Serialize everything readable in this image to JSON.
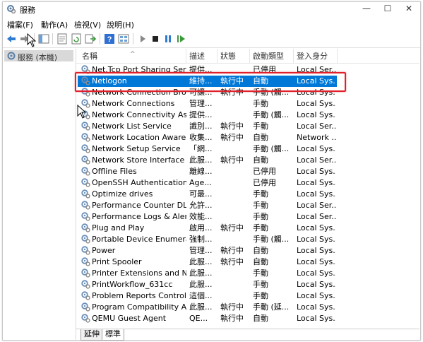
{
  "window": {
    "title": "服務"
  },
  "menu": [
    "檔案(F)",
    "動作(A)",
    "檢視(V)",
    "說明(H)"
  ],
  "toolbar_icons": [
    "back-arrow-icon",
    "forward-arrow-icon",
    "console-tree-icon",
    "properties-icon",
    "refresh-icon",
    "export-list-icon",
    "help-icon",
    "view-icon",
    "play-icon",
    "stop-icon",
    "pause-icon",
    "restart-icon"
  ],
  "tree": {
    "node_label": "服務 (本機)"
  },
  "columns": {
    "name": "名稱",
    "desc": "描述",
    "status": "狀態",
    "startup": "啟動類型",
    "logon": "登入身分"
  },
  "services": [
    {
      "name": "Net.Tcp Port Sharing Servi...",
      "desc": "提供...",
      "status": "",
      "startup": "已停用",
      "logon": "Local Ser..."
    },
    {
      "name": "Netlogon",
      "desc": "維持...",
      "status": "執行中",
      "startup": "自動",
      "logon": "Local Sys...",
      "selected": true
    },
    {
      "name": "Network Connection Broker",
      "desc": "可讓...",
      "status": "執行中",
      "startup": "手動 (觸...",
      "logon": "Local Sys..."
    },
    {
      "name": "Network Connections",
      "desc": "管理...",
      "status": "",
      "startup": "手動",
      "logon": "Local Sys..."
    },
    {
      "name": "Network Connectivity Assi...",
      "desc": "提供...",
      "status": "",
      "startup": "手動 (觸...",
      "logon": "Local Sys..."
    },
    {
      "name": "Network List Service",
      "desc": "識別...",
      "status": "執行中",
      "startup": "手動",
      "logon": "Local Ser..."
    },
    {
      "name": "Network Location Awaren...",
      "desc": "收集...",
      "status": "執行中",
      "startup": "自動",
      "logon": "Network ..."
    },
    {
      "name": "Network Setup Service",
      "desc": "「網...",
      "status": "",
      "startup": "手動 (觸...",
      "logon": "Local Sys..."
    },
    {
      "name": "Network Store Interface S...",
      "desc": "此服...",
      "status": "執行中",
      "startup": "自動",
      "logon": "Local Ser..."
    },
    {
      "name": "Offline Files",
      "desc": "離線...",
      "status": "",
      "startup": "已停用",
      "logon": "Local Sys..."
    },
    {
      "name": "OpenSSH Authentication ...",
      "desc": "Age...",
      "status": "",
      "startup": "已停用",
      "logon": "Local Sys..."
    },
    {
      "name": "Optimize drives",
      "desc": "可最...",
      "status": "",
      "startup": "手動",
      "logon": "Local Sys..."
    },
    {
      "name": "Performance Counter DLL ...",
      "desc": "允許...",
      "status": "",
      "startup": "手動",
      "logon": "Local Ser..."
    },
    {
      "name": "Performance Logs & Alerts",
      "desc": "效能...",
      "status": "",
      "startup": "手動",
      "logon": "Local Ser..."
    },
    {
      "name": "Plug and Play",
      "desc": "啟用...",
      "status": "執行中",
      "startup": "手動",
      "logon": "Local Sys..."
    },
    {
      "name": "Portable Device Enumerat...",
      "desc": "強制...",
      "status": "",
      "startup": "手動 (觸...",
      "logon": "Local Sys..."
    },
    {
      "name": "Power",
      "desc": "管理...",
      "status": "執行中",
      "startup": "自動",
      "logon": "Local Sys..."
    },
    {
      "name": "Print Spooler",
      "desc": "此服...",
      "status": "執行中",
      "startup": "自動",
      "logon": "Local Sys..."
    },
    {
      "name": "Printer Extensions and No...",
      "desc": "此服...",
      "status": "",
      "startup": "手動",
      "logon": "Local Sys..."
    },
    {
      "name": "PrintWorkflow_631cc",
      "desc": "此服...",
      "status": "",
      "startup": "手動",
      "logon": "Local Sys..."
    },
    {
      "name": "Problem Reports Control ...",
      "desc": "這個...",
      "status": "",
      "startup": "手動",
      "logon": "Local Sys..."
    },
    {
      "name": "Program Compatibility As...",
      "desc": "此服...",
      "status": "執行中",
      "startup": "手動 (延...",
      "logon": "Local Sys..."
    },
    {
      "name": "QEMU Guest Agent",
      "desc": "QE...",
      "status": "執行中",
      "startup": "自動",
      "logon": "Local Sys..."
    }
  ],
  "tabs": [
    "延伸",
    "標準"
  ],
  "colors": {
    "selection": "#0078d7",
    "highlight_box": "#e0202a"
  }
}
